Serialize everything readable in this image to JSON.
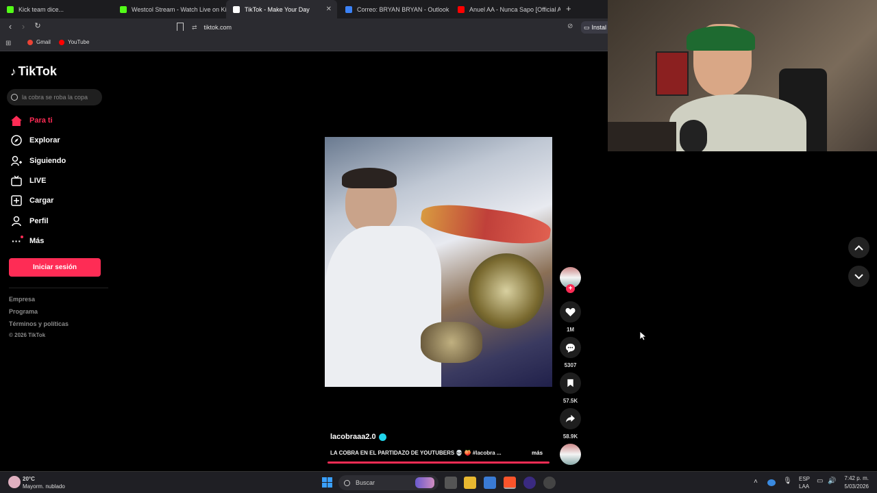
{
  "browser": {
    "tabs": [
      {
        "title": "Kick team dice...",
        "color": "#53fc18"
      },
      {
        "title": "Westcol Stream - Watch Live on Kick",
        "color": "#53fc18"
      },
      {
        "title": "TikTok - Make Your Day",
        "color": "#ffffff"
      },
      {
        "title": "Correo: BRYAN BRYAN - Outlook",
        "color": "#3b82f6"
      },
      {
        "title": "Anuel AA - Nunca Sapo [Official Aud",
        "color": "#ff0000"
      }
    ],
    "url": "tiktok.com",
    "install_label": "Instal",
    "bookmarks": [
      {
        "label": "Gmail",
        "color": "#ea4335"
      },
      {
        "label": "YouTube",
        "color": "#ff0000"
      }
    ]
  },
  "tiktok": {
    "logo": "TikTok",
    "search_placeholder": "la cobra se roba la copa",
    "nav": [
      {
        "label": "Para ti",
        "icon": "home-icon",
        "active": true
      },
      {
        "label": "Explorar",
        "icon": "compass-icon"
      },
      {
        "label": "Siguiendo",
        "icon": "following-icon"
      },
      {
        "label": "LIVE",
        "icon": "live-icon"
      },
      {
        "label": "Cargar",
        "icon": "upload-icon"
      },
      {
        "label": "Perfil",
        "icon": "profile-icon"
      },
      {
        "label": "Más",
        "icon": "more-icon"
      }
    ],
    "login_label": "Iniciar sesión",
    "footer": [
      "Empresa",
      "Programa",
      "Términos y políticas",
      "© 2026 TikTok"
    ],
    "video": {
      "author": "lacobraaa2.0",
      "caption": "LA COBRA EN EL PARTIDAZO DE YOUTUBERS 💀 🍑 #lacobra ...",
      "more": "más",
      "likes": "1M",
      "comments": "5307",
      "saves": "57.5K",
      "shares": "58.9K"
    }
  },
  "taskbar": {
    "weather_temp": "20°C",
    "weather_desc": "Mayorm. nublado",
    "search_label": "Buscar",
    "lang_top": "ESP",
    "lang_bottom": "LAA",
    "time": "7:42 p. m.",
    "date": "5/03/2026"
  },
  "colors": {
    "accent": "#fe2c55"
  }
}
